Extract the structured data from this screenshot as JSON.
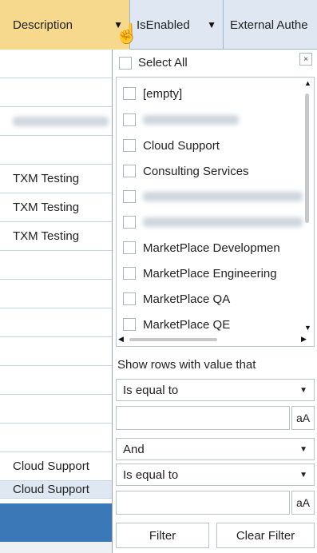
{
  "header": {
    "description": "Description",
    "is_enabled": "IsEnabled",
    "external_auth": "External Authe"
  },
  "grid": {
    "rows": [
      "",
      "",
      "",
      "",
      "TXM Testing",
      "TXM Testing",
      "TXM Testing",
      "",
      "",
      "",
      "",
      "",
      "",
      "",
      "Cloud Support",
      "Cloud Support"
    ]
  },
  "filter": {
    "select_all": "Select All",
    "close": "×",
    "items": [
      "[empty]",
      "",
      "Cloud Support",
      "Consulting Services",
      "",
      "",
      "MarketPlace Developmen",
      "MarketPlace Engineering",
      "MarketPlace QA",
      "MarketPlace QE"
    ],
    "show_rows_label": "Show rows with value that",
    "operator1": "Is equal to",
    "logic": "And",
    "operator2": "Is equal to",
    "match_case": "aA",
    "filter_btn": "Filter",
    "clear_btn": "Clear Filter"
  },
  "icons": {
    "filter": "filter-funnel-icon",
    "cursor": "hand-pointer-icon"
  }
}
